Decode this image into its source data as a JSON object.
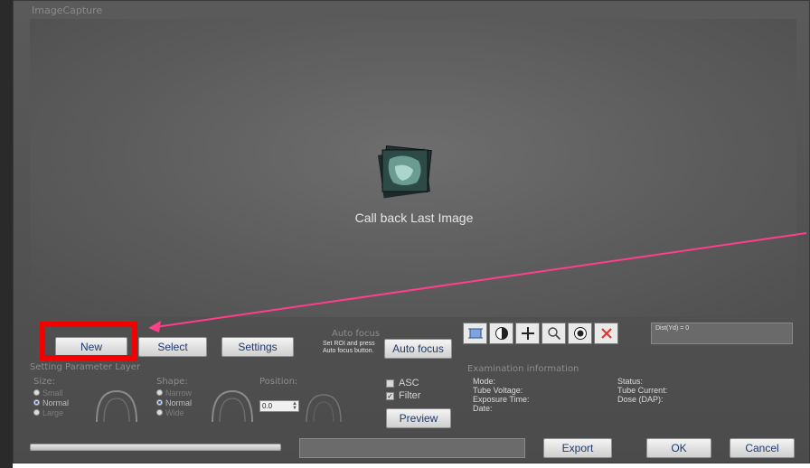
{
  "window": {
    "title": "ImageCapture"
  },
  "viewer": {
    "callback_label": "Call back Last Image"
  },
  "acquisition": {
    "new_label": "New",
    "select_label": "Select",
    "settings_label": "Settings",
    "auto_focus_heading": "Auto focus",
    "auto_focus_hint": "Set ROI and press Auto focus button.",
    "auto_focus_button": "Auto focus"
  },
  "tools": {
    "icons": [
      "select-roi-icon",
      "contrast-icon",
      "crosshair-icon",
      "zoom-icon",
      "record-icon",
      "delete-icon"
    ],
    "distance_readout": "Dist(Yd) = 0"
  },
  "settings_panel": {
    "heading": "Setting Parameter Layer",
    "size_label": "Size:",
    "size_options": [
      "Small",
      "Normal",
      "Large"
    ],
    "size_selected": "Normal",
    "shape_label": "Shape:",
    "shape_options": [
      "Narrow",
      "Normal",
      "Wide"
    ],
    "shape_selected": "Normal",
    "position_label": "Position:",
    "position_value": "0.0",
    "asc_label": "ASC",
    "asc_checked": false,
    "filter_label": "Filter",
    "filter_checked": true,
    "preview_label": "Preview"
  },
  "exam_info": {
    "heading": "Examination information",
    "mode": "Mode:",
    "tube_voltage": "Tube Voltage:",
    "exposure_time": "Exposure Time:",
    "date": "Date:",
    "status": "Status:",
    "tube_current": "Tube Current:",
    "dose": "Dose (DAP):"
  },
  "footer": {
    "progress": 0,
    "export_label": "Export",
    "ok_label": "OK",
    "cancel_label": "Cancel"
  },
  "annotation": {
    "highlight_color": "#f20000",
    "arrow_color": "#ff3f8a"
  }
}
